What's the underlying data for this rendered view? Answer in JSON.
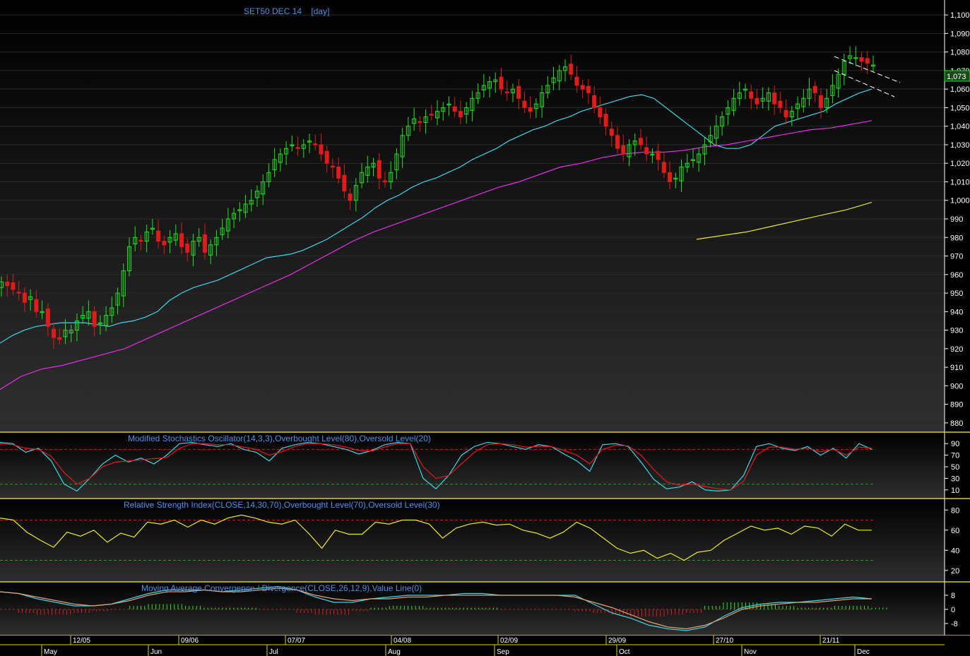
{
  "main": {
    "title": "SET50 DEC 14",
    "interval": "[day]",
    "last_price_label": "1,073",
    "y_ticks": [
      "1,100",
      "1,090",
      "1,080",
      "1,070",
      "1,060",
      "1,050",
      "1,040",
      "1,030",
      "1,020",
      "1,010",
      "1,000",
      "990",
      "980",
      "970",
      "960",
      "950",
      "940",
      "930",
      "920",
      "910",
      "900",
      "890",
      "880"
    ]
  },
  "panels": {
    "stoch": {
      "title": "Modified Stochastics Oscillator(14,3,3),Overbought Level(80),Oversold Level(20)",
      "ticks": [
        "90",
        "70",
        "50",
        "30",
        "10"
      ]
    },
    "rsi": {
      "title": "Relative Strength Index(CLOSE,14,30,70),Overbought Level(70),Oversold Level(30)",
      "ticks": [
        "80",
        "60",
        "40",
        "20"
      ]
    },
    "macd": {
      "title": "Moving Average Convergence / Divergence(CLOSE,26,12,9),Value Line(0)",
      "ticks": [
        "8",
        "0",
        "-8"
      ]
    }
  },
  "x_axis": {
    "top_dates": [
      "12/05",
      "09/06",
      "07/07",
      "04/08",
      "02/09",
      "29/09",
      "27/10",
      "21/11"
    ],
    "months": [
      "May",
      "Jun",
      "Jul",
      "Aug",
      "Sep",
      "Oct",
      "Nov",
      "Dec"
    ]
  },
  "colors": {
    "background": "#000000",
    "up_candle": "#19e619",
    "down_candle": "#e11a1a",
    "ma_fast": "#3fd6e6",
    "ma_mid": "#e62fe6",
    "ma_slow": "#eaea2a",
    "stoch_k": "#3fd6e6",
    "stoch_d": "#e11a1a",
    "rsi": "#eaea2a",
    "panel_border": "#d8d020",
    "title_text": "#4f8fe8"
  },
  "chart_data": [
    {
      "type": "candlestick",
      "title": "SET50 DEC 14",
      "ylim": [
        875,
        1105
      ],
      "series": [
        {
          "name": "price",
          "close": [
            956,
            954,
            952,
            950,
            945,
            948,
            940,
            940,
            932,
            926,
            925,
            930,
            930,
            935,
            938,
            940,
            932,
            934,
            938,
            942,
            950,
            962,
            975,
            980,
            978,
            983,
            985,
            978,
            976,
            980,
            982,
            975,
            972,
            978,
            980,
            972,
            976,
            980,
            985,
            990,
            993,
            995,
            998,
            1000,
            1005,
            1010,
            1015,
            1022,
            1025,
            1028,
            1030,
            1028,
            1030,
            1032,
            1030,
            1025,
            1020,
            1018,
            1012,
            1005,
            1000,
            1008,
            1015,
            1018,
            1020,
            1012,
            1010,
            1015,
            1025,
            1035,
            1040,
            1044,
            1042,
            1045,
            1046,
            1048,
            1050,
            1052,
            1048,
            1045,
            1050,
            1055,
            1058,
            1062,
            1064,
            1065,
            1060,
            1058,
            1060,
            1055,
            1050,
            1048,
            1052,
            1058,
            1062,
            1066,
            1070,
            1072,
            1068,
            1062,
            1060,
            1058,
            1050,
            1045,
            1040,
            1035,
            1028,
            1025,
            1030,
            1032,
            1030,
            1025,
            1025,
            1022,
            1015,
            1010,
            1012,
            1018,
            1020,
            1022,
            1025,
            1030,
            1035,
            1040,
            1045,
            1050,
            1055,
            1058,
            1060,
            1055,
            1052,
            1055,
            1058,
            1052,
            1050,
            1045,
            1048,
            1052,
            1055,
            1060,
            1058,
            1050,
            1055,
            1062,
            1068,
            1075,
            1078,
            1077,
            1075,
            1074,
            1073
          ]
        },
        {
          "name": "MA fast",
          "values": [
            923,
            927,
            930,
            932,
            933,
            934,
            934,
            934,
            933,
            932,
            934,
            935,
            937,
            940,
            946,
            950,
            953,
            955,
            957,
            960,
            963,
            966,
            969,
            970,
            971,
            973,
            976,
            979,
            983,
            987,
            991,
            996,
            1000,
            1003,
            1007,
            1010,
            1012,
            1015,
            1018,
            1022,
            1025,
            1028,
            1032,
            1035,
            1038,
            1040,
            1043,
            1045,
            1048,
            1050,
            1052,
            1054,
            1056,
            1057,
            1055,
            1050,
            1045,
            1040,
            1035,
            1030,
            1028,
            1028,
            1030,
            1035,
            1040,
            1042,
            1044,
            1046,
            1048,
            1052,
            1055,
            1058,
            1060
          ]
        },
        {
          "name": "MA mid",
          "values": [
            898,
            905,
            909,
            911,
            914,
            917,
            920,
            925,
            930,
            935,
            940,
            945,
            950,
            955,
            960,
            966,
            972,
            978,
            983,
            987,
            991,
            995,
            999,
            1003,
            1007,
            1010,
            1014,
            1018,
            1020,
            1023,
            1025,
            1026,
            1026,
            1027,
            1029,
            1030,
            1032,
            1034,
            1036,
            1038,
            1039,
            1041,
            1043
          ]
        },
        {
          "name": "MA slow",
          "values": [
            979,
            981,
            983,
            986,
            989,
            992,
            995,
            999
          ]
        }
      ]
    },
    {
      "type": "line",
      "title": "Modified Stochastics Oscillator(14,3,3),Overbought Level(80),Oversold Level(20)",
      "ylim": [
        0,
        100
      ],
      "reference_lines": [
        80,
        20
      ],
      "series": [
        {
          "name": "%K",
          "values": [
            92,
            90,
            75,
            82,
            60,
            20,
            8,
            30,
            55,
            70,
            58,
            65,
            55,
            70,
            90,
            92,
            88,
            85,
            90,
            80,
            75,
            60,
            82,
            88,
            92,
            90,
            85,
            80,
            72,
            78,
            88,
            92,
            90,
            30,
            12,
            35,
            70,
            85,
            92,
            90,
            85,
            80,
            88,
            85,
            72,
            60,
            42,
            88,
            90,
            85,
            58,
            28,
            12,
            15,
            24,
            10,
            8,
            10,
            35,
            85,
            90,
            82,
            78,
            85,
            70,
            82,
            65,
            90,
            80
          ]
        },
        {
          "name": "%D",
          "values": [
            90,
            88,
            82,
            80,
            68,
            40,
            20,
            30,
            50,
            58,
            60,
            62,
            64,
            66,
            82,
            90,
            90,
            88,
            88,
            84,
            80,
            70,
            76,
            85,
            90,
            90,
            88,
            84,
            78,
            77,
            84,
            90,
            90,
            50,
            30,
            35,
            55,
            75,
            88,
            90,
            88,
            84,
            85,
            85,
            78,
            70,
            55,
            80,
            87,
            86,
            70,
            45,
            24,
            18,
            20,
            16,
            12,
            10,
            25,
            70,
            84,
            84,
            80,
            82,
            76,
            80,
            70,
            84,
            82
          ]
        }
      ]
    },
    {
      "type": "line",
      "title": "Relative Strength Index(CLOSE,14,30,70),Overbought Level(70),Oversold Level(30)",
      "ylim": [
        10,
        90
      ],
      "reference_lines": [
        70,
        30
      ],
      "series": [
        {
          "name": "RSI",
          "values": [
            72,
            70,
            58,
            50,
            43,
            58,
            54,
            60,
            48,
            57,
            53,
            68,
            66,
            70,
            63,
            70,
            66,
            72,
            75,
            72,
            68,
            66,
            70,
            57,
            42,
            60,
            56,
            56,
            68,
            66,
            70,
            70,
            66,
            52,
            62,
            66,
            68,
            65,
            66,
            60,
            57,
            52,
            58,
            68,
            62,
            52,
            42,
            37,
            40,
            32,
            37,
            30,
            38,
            40,
            50,
            57,
            64,
            60,
            62,
            56,
            64,
            62,
            54,
            66,
            60,
            60
          ]
        }
      ]
    },
    {
      "type": "line",
      "title": "Moving Average Convergence / Divergence(CLOSE,26,12,9),Value Line(0)",
      "ylim": [
        -14,
        14
      ],
      "reference_lines": [
        0
      ],
      "series": [
        {
          "name": "MACD",
          "values": [
            10,
            9,
            6,
            4,
            2,
            2,
            3,
            6,
            9,
            11,
            11,
            11,
            10,
            11,
            12,
            13,
            11,
            7,
            4,
            4,
            6,
            7,
            8,
            8,
            8,
            9,
            9,
            8,
            8,
            8,
            8,
            8,
            3,
            -2,
            -5,
            -9,
            -11,
            -12,
            -10,
            -4,
            1,
            3,
            4,
            4,
            5,
            6,
            7,
            6
          ]
        },
        {
          "name": "Signal",
          "values": [
            10,
            9,
            7,
            5,
            3,
            2,
            3,
            5,
            8,
            10,
            10,
            11,
            10,
            10,
            11,
            12,
            11,
            8,
            6,
            5,
            6,
            6,
            7,
            7,
            8,
            8,
            8,
            8,
            8,
            8,
            8,
            7,
            4,
            1,
            -3,
            -7,
            -10,
            -11,
            -9,
            -5,
            0,
            2,
            3,
            4,
            4,
            5,
            6,
            6
          ]
        },
        {
          "name": "Histogram",
          "values": [
            0,
            -2,
            -3,
            -3,
            -2,
            -1,
            0,
            2,
            3,
            3,
            2,
            1,
            1,
            1,
            0,
            0,
            -2,
            -3,
            -3,
            -1,
            1,
            2,
            2,
            1,
            1,
            1,
            1,
            0,
            0,
            0,
            0,
            -1,
            -2,
            -3,
            -4,
            -4,
            -3,
            -2,
            2,
            4,
            4,
            3,
            2,
            1,
            1,
            2,
            2,
            1
          ]
        }
      ]
    }
  ]
}
